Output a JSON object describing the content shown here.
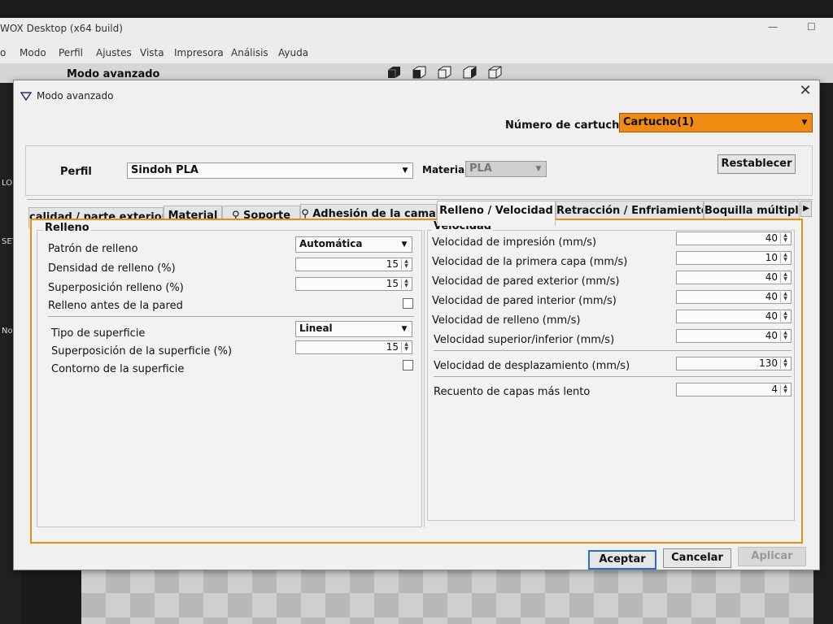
{
  "app": {
    "title": "WOX Desktop (x64 build)",
    "menu": [
      "o",
      "Modo",
      "Perfil",
      "Ajustes",
      "Vista",
      "Impresora",
      "Análisis",
      "Ayuda"
    ],
    "toolbar_title": "Modo avanzado",
    "left_strip": [
      "LO",
      "SET",
      "No"
    ]
  },
  "dialog": {
    "title": "Modo avanzado",
    "cartridge_label": "Número de cartucho",
    "cartridge_value": "Cartucho(1)",
    "profile_label": "Perfil",
    "profile_value": "Sindoh PLA",
    "material_label": "Material",
    "material_value": "PLA",
    "reset_label": "Restablecer",
    "tabs": [
      {
        "label": "calidad / parte exterior"
      },
      {
        "label": "Material"
      },
      {
        "label": "Soporte"
      },
      {
        "label": "Adhesión de la cama"
      },
      {
        "label": "Relleno / Velocidad"
      },
      {
        "label": "Retracción / Enfriamiento"
      },
      {
        "label": "Boquilla múltiple"
      }
    ],
    "accept_label": "Aceptar",
    "cancel_label": "Cancelar",
    "apply_label": "Aplicar"
  },
  "relleno": {
    "title": "Relleno",
    "pattern_label": "Patrón de relleno",
    "pattern_value": "Automática",
    "density_label": "Densidad de relleno (%)",
    "density_value": "15",
    "overlap_label": "Superposición relleno (%)",
    "overlap_value": "15",
    "before_wall_label": "Relleno antes de la pared",
    "surface_type_label": "Tipo de superficie",
    "surface_type_value": "Lineal",
    "surface_overlap_label": "Superposición de la superficie (%)",
    "surface_overlap_value": "15",
    "surface_contour_label": "Contorno de la superficie"
  },
  "velocidad": {
    "title": "Velocidad",
    "rows": [
      {
        "label": "Velocidad de impresión (mm/s)",
        "value": "40"
      },
      {
        "label": "Velocidad de la primera capa (mm/s)",
        "value": "10"
      },
      {
        "label": "Velocidad de pared exterior (mm/s)",
        "value": "40"
      },
      {
        "label": "Velocidad de pared interior (mm/s)",
        "value": "40"
      },
      {
        "label": "Velocidad de relleno (mm/s)",
        "value": "40"
      },
      {
        "label": "Velocidad superior/inferior (mm/s)",
        "value": "40"
      }
    ],
    "travel_label": "Velocidad de desplazamiento (mm/s)",
    "travel_value": "130",
    "slow_layers_label": "Recuento de capas más lento",
    "slow_layers_value": "4"
  },
  "colors": {
    "accent_orange": "#f08a10",
    "primary_border": "#2a6fc9"
  }
}
